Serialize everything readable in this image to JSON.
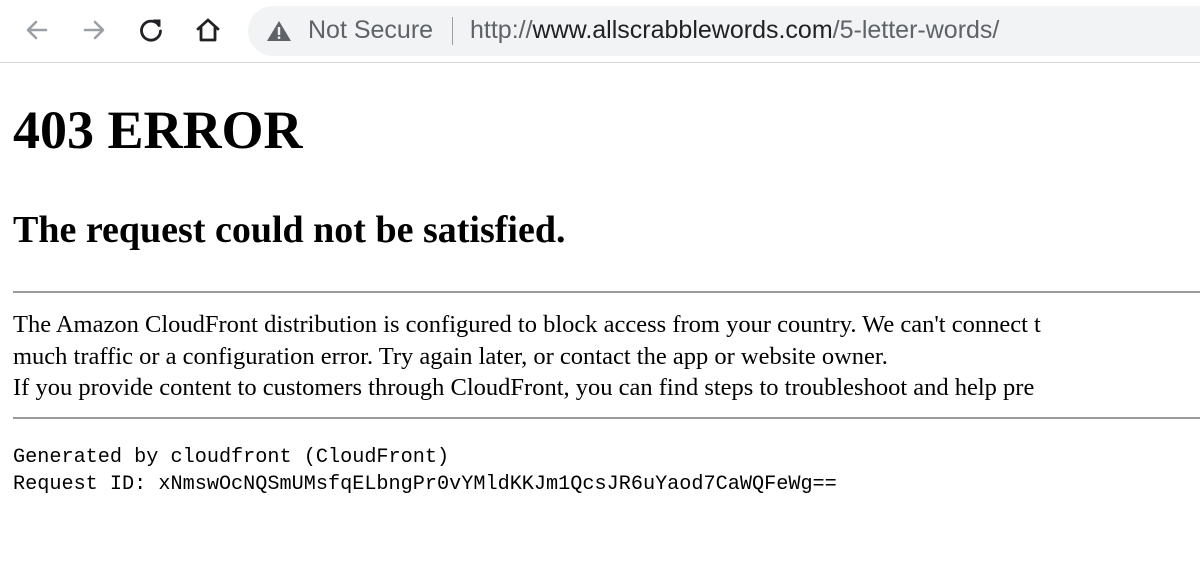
{
  "browser": {
    "back_icon": "arrow-left-icon",
    "forward_icon": "arrow-right-icon",
    "reload_icon": "reload-icon",
    "home_icon": "home-icon",
    "security_icon": "warning-triangle-icon",
    "security_label": "Not Secure",
    "url_protocol": "http://",
    "url_host": "www.allscrabblewords.com",
    "url_path": "/5-letter-words/"
  },
  "page": {
    "heading": "403 ERROR",
    "subheading": "The request could not be satisfied.",
    "body_lines": [
      "The Amazon CloudFront distribution is configured to block access from your country. We can't connect t",
      "much traffic or a configuration error. Try again later, or contact the app or website owner.",
      "If you provide content to customers through CloudFront, you can find steps to troubleshoot and help pre"
    ],
    "footer_generated": "Generated by cloudfront (CloudFront)",
    "footer_request_id": "Request ID: xNmswOcNQSmUMsfqELbngPr0vYMldKKJm1QcsJR6uYaod7CaWQFeWg=="
  },
  "colors": {
    "omnibox_background": "#f1f3f4",
    "icon_color": "#202124",
    "disabled_icon_color": "#9aa0a6",
    "rule_color": "#9a9a9a"
  }
}
